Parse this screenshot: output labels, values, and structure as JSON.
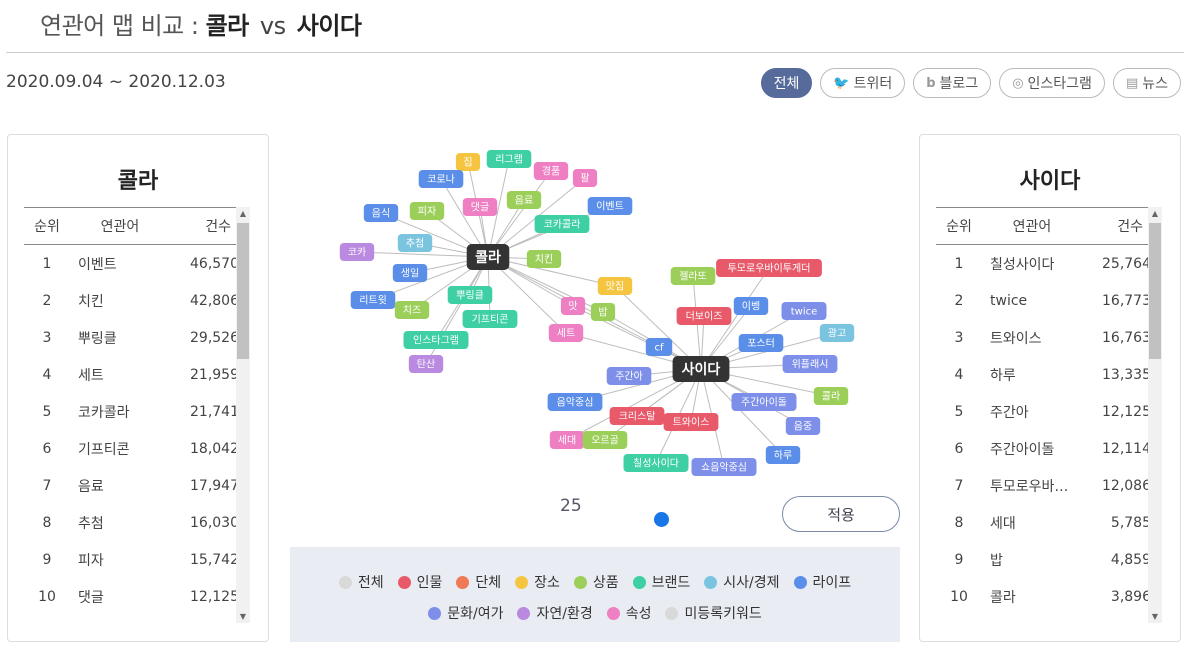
{
  "header": {
    "title_prefix": "연관어 맵 비교 :",
    "left_term": "콜라",
    "vs": "vs",
    "right_term": "사이다",
    "date_range": "2020.09.04 ~ 2020.12.03"
  },
  "filters": {
    "all": "전체",
    "twitter": "트위터",
    "blog": "블로그",
    "instagram": "인스타그램",
    "news": "뉴스"
  },
  "table_headers": {
    "rank": "순위",
    "word": "연관어",
    "count": "건수"
  },
  "left_panel": {
    "title": "콜라",
    "rows": [
      {
        "rank": "1",
        "word": "이벤트",
        "count": "46,570"
      },
      {
        "rank": "2",
        "word": "치킨",
        "count": "42,806"
      },
      {
        "rank": "3",
        "word": "뿌링클",
        "count": "29,526"
      },
      {
        "rank": "4",
        "word": "세트",
        "count": "21,959"
      },
      {
        "rank": "5",
        "word": "코카콜라",
        "count": "21,741"
      },
      {
        "rank": "6",
        "word": "기프티콘",
        "count": "18,042"
      },
      {
        "rank": "7",
        "word": "음료",
        "count": "17,947"
      },
      {
        "rank": "8",
        "word": "추첨",
        "count": "16,030"
      },
      {
        "rank": "9",
        "word": "피자",
        "count": "15,742"
      },
      {
        "rank": "10",
        "word": "댓글",
        "count": "12,125"
      }
    ]
  },
  "right_panel": {
    "title": "사이다",
    "rows": [
      {
        "rank": "1",
        "word": "칠성사이다",
        "count": "25,764"
      },
      {
        "rank": "2",
        "word": "twice",
        "count": "16,773"
      },
      {
        "rank": "3",
        "word": "트와이스",
        "count": "16,763"
      },
      {
        "rank": "4",
        "word": "하루",
        "count": "13,335"
      },
      {
        "rank": "5",
        "word": "주간아",
        "count": "12,125"
      },
      {
        "rank": "6",
        "word": "주간아이돌",
        "count": "12,114"
      },
      {
        "rank": "7",
        "word": "투모로우바…",
        "count": "12,086"
      },
      {
        "rank": "8",
        "word": "세대",
        "count": "5,785"
      },
      {
        "rank": "9",
        "word": "밥",
        "count": "4,859"
      },
      {
        "rank": "10",
        "word": "콜라",
        "count": "3,896"
      }
    ]
  },
  "colors": {
    "people": "#e85a6a",
    "group": "#f07a55",
    "place": "#f5c542",
    "product": "#9ccf5a",
    "brand": "#3fcfa5",
    "social": "#7ac4e0",
    "life": "#5a8ee8",
    "culture": "#7d8fe8",
    "nature": "#b98ae0",
    "attribute": "#ee7fc3",
    "unregistered": "#d9d9d9",
    "center": "#333333",
    "accent": "#566b9b"
  },
  "network": {
    "hubs": [
      {
        "id": "cola",
        "label": "콜라"
      },
      {
        "id": "cider",
        "label": "사이다"
      }
    ],
    "nodes": [
      {
        "label": "집",
        "cat": "place",
        "hub": "cola"
      },
      {
        "label": "리그램",
        "cat": "brand",
        "hub": "cola"
      },
      {
        "label": "경품",
        "cat": "attribute",
        "hub": "cola"
      },
      {
        "label": "팔",
        "cat": "attribute",
        "hub": "cola"
      },
      {
        "label": "코로나",
        "cat": "life",
        "hub": "cola"
      },
      {
        "label": "피자",
        "cat": "product",
        "hub": "cola"
      },
      {
        "label": "댓글",
        "cat": "attribute",
        "hub": "cola"
      },
      {
        "label": "음료",
        "cat": "product",
        "hub": "cola"
      },
      {
        "label": "이벤트",
        "cat": "life",
        "hub": "cola"
      },
      {
        "label": "음식",
        "cat": "life",
        "hub": "cola"
      },
      {
        "label": "코카콜라",
        "cat": "brand",
        "hub": "cola"
      },
      {
        "label": "추첨",
        "cat": "social",
        "hub": "cola"
      },
      {
        "label": "코카",
        "cat": "nature",
        "hub": "cola"
      },
      {
        "label": "치킨",
        "cat": "product",
        "hub": "cola"
      },
      {
        "label": "생일",
        "cat": "life",
        "hub": "cola"
      },
      {
        "label": "뿌링클",
        "cat": "brand",
        "hub": "cola"
      },
      {
        "label": "리트윗",
        "cat": "life",
        "hub": "cola"
      },
      {
        "label": "치즈",
        "cat": "product",
        "hub": "cola"
      },
      {
        "label": "기프티콘",
        "cat": "brand",
        "hub": "cola"
      },
      {
        "label": "인스타그램",
        "cat": "brand",
        "hub": "cola"
      },
      {
        "label": "탄산",
        "cat": "nature",
        "hub": "cola"
      },
      {
        "label": "맛집",
        "cat": "place",
        "hub": "both"
      },
      {
        "label": "맛",
        "cat": "attribute",
        "hub": "both"
      },
      {
        "label": "밥",
        "cat": "product",
        "hub": "both"
      },
      {
        "label": "세트",
        "cat": "attribute",
        "hub": "both"
      },
      {
        "label": "cf",
        "cat": "life",
        "hub": "both"
      },
      {
        "label": "투모로우바이투게더",
        "cat": "people",
        "hub": "cider"
      },
      {
        "label": "젤라또",
        "cat": "product",
        "hub": "cider"
      },
      {
        "label": "이벵",
        "cat": "life",
        "hub": "cider"
      },
      {
        "label": "twice",
        "cat": "culture",
        "hub": "cider"
      },
      {
        "label": "더보이즈",
        "cat": "people",
        "hub": "cider"
      },
      {
        "label": "광고",
        "cat": "social",
        "hub": "cider"
      },
      {
        "label": "포스터",
        "cat": "life",
        "hub": "cider"
      },
      {
        "label": "위플래시",
        "cat": "culture",
        "hub": "cider"
      },
      {
        "label": "주간아",
        "cat": "culture",
        "hub": "cider"
      },
      {
        "label": "콜라",
        "cat": "product",
        "hub": "cider"
      },
      {
        "label": "음악중심",
        "cat": "life",
        "hub": "cider"
      },
      {
        "label": "주간아이돌",
        "cat": "culture",
        "hub": "cider"
      },
      {
        "label": "크리스탈",
        "cat": "people",
        "hub": "cider"
      },
      {
        "label": "트와이스",
        "cat": "people",
        "hub": "cider"
      },
      {
        "label": "음중",
        "cat": "culture",
        "hub": "cider"
      },
      {
        "label": "세대",
        "cat": "attribute",
        "hub": "cider"
      },
      {
        "label": "오르골",
        "cat": "product",
        "hub": "cider"
      },
      {
        "label": "하루",
        "cat": "life",
        "hub": "cider"
      },
      {
        "label": "칠성사이다",
        "cat": "brand",
        "hub": "cider"
      },
      {
        "label": "쇼음악중심",
        "cat": "culture",
        "hub": "cider"
      }
    ]
  },
  "controls": {
    "slider_value": "25",
    "apply_label": "적용"
  },
  "legend": {
    "row1": [
      {
        "label": "전체",
        "color": "#d9d9d9"
      },
      {
        "label": "인물",
        "color": "#e85a6a"
      },
      {
        "label": "단체",
        "color": "#f07a55"
      },
      {
        "label": "장소",
        "color": "#f5c542"
      },
      {
        "label": "상품",
        "color": "#9ccf5a"
      },
      {
        "label": "브랜드",
        "color": "#3fcfa5"
      },
      {
        "label": "시사/경제",
        "color": "#7ac4e0"
      },
      {
        "label": "라이프",
        "color": "#5a8ee8"
      }
    ],
    "row2": [
      {
        "label": "문화/여가",
        "color": "#7d8fe8"
      },
      {
        "label": "자연/환경",
        "color": "#b98ae0"
      },
      {
        "label": "속성",
        "color": "#ee7fc3"
      },
      {
        "label": "미등록키워드",
        "color": "#d9d9d9"
      }
    ]
  }
}
